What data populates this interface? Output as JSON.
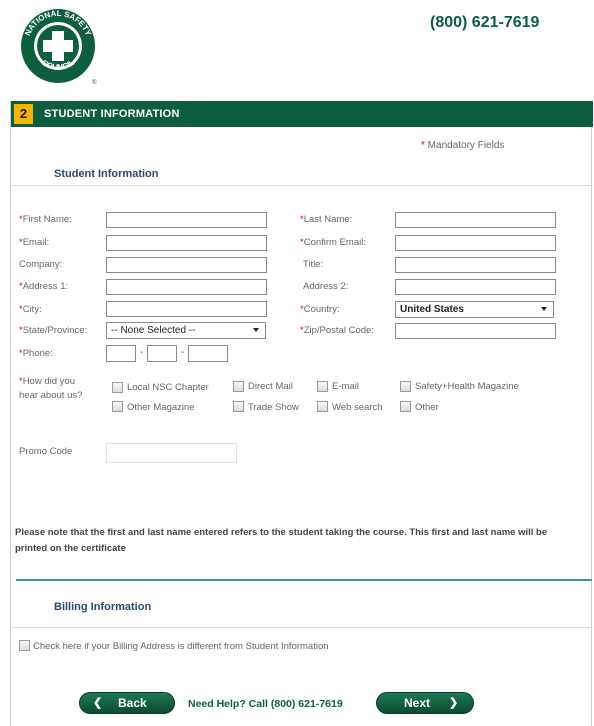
{
  "header": {
    "phone": "(800) 621-7619",
    "logo": {
      "top_text": "NATIONAL SAFETY",
      "bottom_text": "COUNCIL",
      "registered_mark": "®",
      "color": "#0d5e3d"
    }
  },
  "section": {
    "step_number": "2",
    "title": "STUDENT INFORMATION",
    "mandatory_star": "*",
    "mandatory_text": " Mandatory Fields",
    "subhead_student": "Student Information",
    "subhead_billing": "Billing Information"
  },
  "form": {
    "first_name_label": "First Name:",
    "last_name_label": "Last Name:",
    "email_label": "Email:",
    "confirm_email_label": "Confirm Email:",
    "company_label": "Company:",
    "title_label": "Title:",
    "address1_label": "Address 1:",
    "address2_label": "Address 2:",
    "city_label": "City:",
    "country_label": "Country:",
    "country_value": "United States",
    "state_label": "State/Province:",
    "state_value": "-- None Selected --",
    "zip_label": "Zip/Postal Code:",
    "phone_label": "Phone:",
    "phone_dash": "-",
    "hear_label_line1": "How did you",
    "hear_label_line2": "hear about us?",
    "hear_options": [
      "Local NSC Chapter",
      "Direct Mail",
      "E-mail",
      "Safety+Health Magazine",
      "Other Magazine",
      "Trade Show",
      "Web search",
      "Other"
    ],
    "promo_label": "Promo Code"
  },
  "note": "Please note that the first and last name entered refers to the student taking the course. This first and last name will be printed on the certificate",
  "billing": {
    "checkbox_label": "Check here if your Billing Address is different from Student Information"
  },
  "footer": {
    "back_label": "Back",
    "back_icon": "chevron-left-icon",
    "help_text": "Need Help? Call (800) 621-7619",
    "next_label": "Next",
    "next_icon": "chevron-right-icon"
  },
  "colors": {
    "brand_green": "#0d5e3d",
    "step_badge": "#f4b400",
    "required_star": "#c8102e",
    "subhead_blue": "#2c4a6e"
  }
}
